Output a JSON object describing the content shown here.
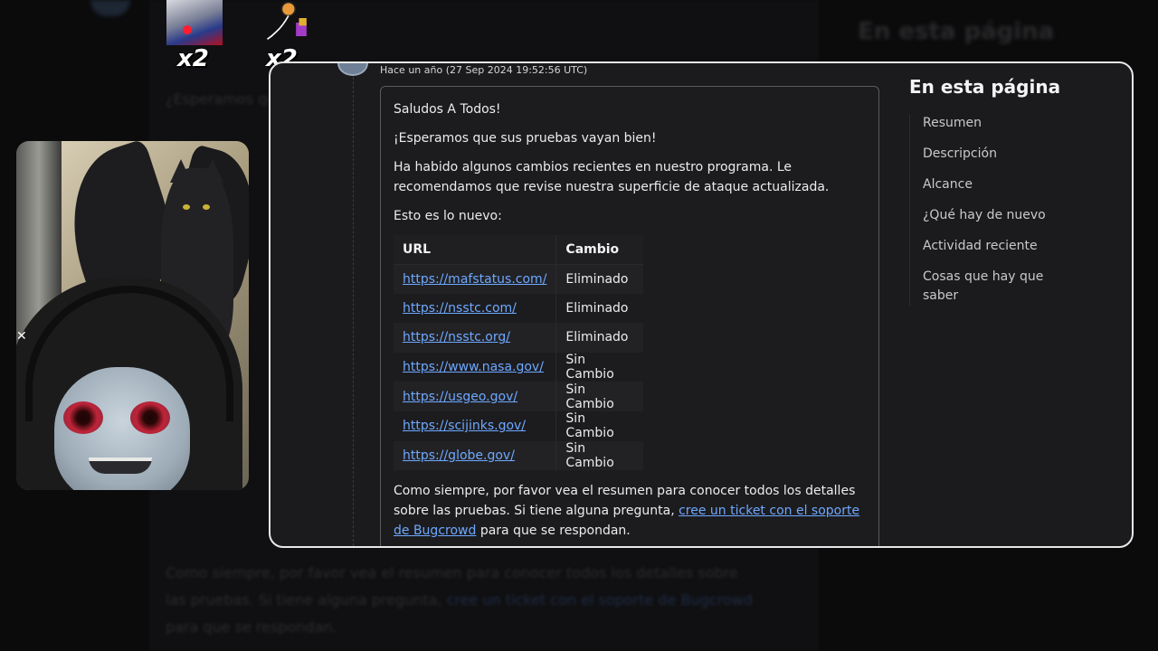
{
  "background": {
    "title": "En esta página",
    "lines": [
      "¿Esperamos que sus pruebas",
      "Como siempre, por favor vea el resumen para conocer todos los detalles sobre",
      "las pruebas. Si tiene alguna pregunta,",
      "para que se respondan."
    ],
    "link": "cree un ticket con el soporte de Bugcrowd"
  },
  "emotes": [
    {
      "multiplier": "x2"
    },
    {
      "multiplier": "x2"
    }
  ],
  "post": {
    "timestamp": "Hace un año (27 Sep 2024 19:52:56 UTC)",
    "greeting": "Saludos A Todos!",
    "line2": "¡Esperamos que sus pruebas vayan bien!",
    "line3": "Ha habido algunos cambios recientes en nuestro programa. Le recomendamos que revise nuestra superficie de ataque actualizada.",
    "line4": "Esto es lo nuevo:",
    "table": {
      "headers": {
        "url": "URL",
        "change": "Cambio"
      },
      "rows": [
        {
          "url": "https://mafstatus.com/",
          "change": "Eliminado"
        },
        {
          "url": "https://nsstc.com/",
          "change": "Eliminado"
        },
        {
          "url": "https://nsstc.org/",
          "change": "Eliminado"
        },
        {
          "url": "https://www.nasa.gov/",
          "change": "Sin Cambio"
        },
        {
          "url": "https://usgeo.gov/",
          "change": "Sin Cambio"
        },
        {
          "url": "https://scijinks.gov/",
          "change": "Sin Cambio"
        },
        {
          "url": "https://globe.gov/",
          "change": "Sin Cambio"
        }
      ]
    },
    "footer_pre": "Como siempre, por favor vea el resumen para conocer todos los detalles sobre las pruebas. Si tiene alguna pregunta,",
    "footer_link": "cree un ticket con el soporte de Bugcrowd",
    "footer_post": "para que se respondan."
  },
  "toc": {
    "title": "En esta página",
    "items": [
      "Resumen",
      "Descripción",
      "Alcance",
      "¿Qué hay de nuevo",
      "Actividad reciente",
      "Cosas que hay que saber"
    ]
  },
  "colors": {
    "link": "#6ea8ff",
    "card_bg": "#1b1b1d",
    "card_border": "#e8e8e8"
  }
}
